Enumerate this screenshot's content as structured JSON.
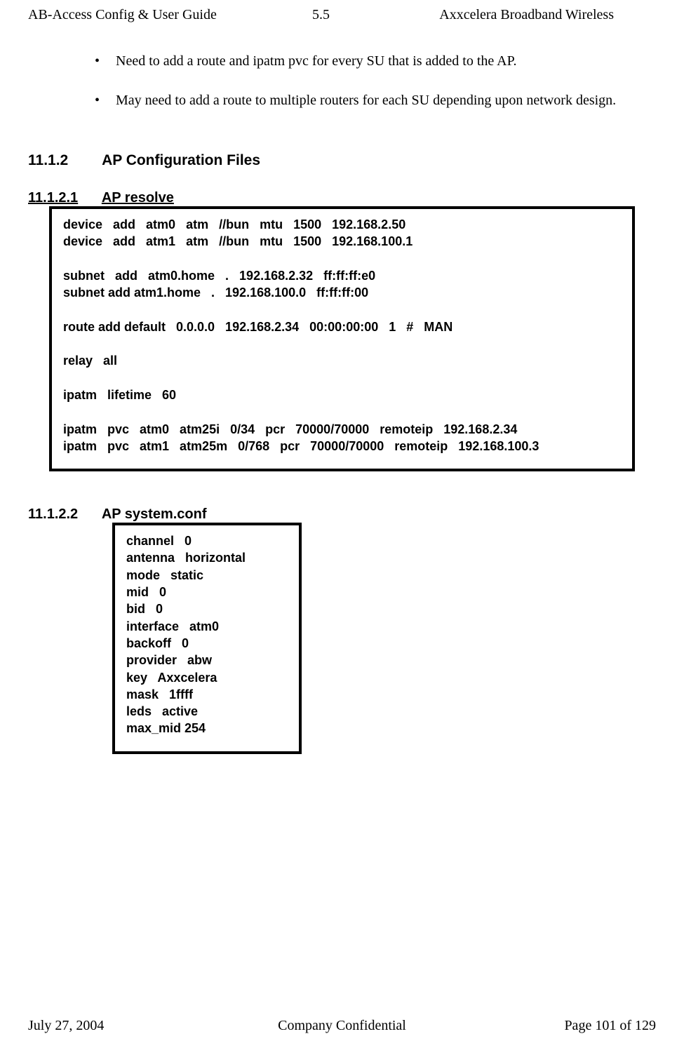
{
  "header": {
    "left": "AB-Access Config & User Guide",
    "center": "5.5",
    "right": "Axxcelera Broadband Wireless"
  },
  "bullets": [
    "Need to add a route and ipatm pvc for every SU that is added to the AP.",
    "May need to add a route to multiple routers for each SU depending upon network design."
  ],
  "sections": {
    "s11_1_2": {
      "number": "11.1.2",
      "title": "AP Configuration Files"
    },
    "s11_1_2_1": {
      "number": "11.1.2.1",
      "title": "AP resolve",
      "code": "device   add   atm0   atm   //bun   mtu   1500   192.168.2.50\ndevice   add   atm1   atm   //bun   mtu   1500   192.168.100.1\n\nsubnet   add   atm0.home   .   192.168.2.32   ff:ff:ff:e0\nsubnet add atm1.home   .   192.168.100.0   ff:ff:ff:00\n\nroute add default   0.0.0.0   192.168.2.34   00:00:00:00   1   #   MAN\n\nrelay   all\n\nipatm   lifetime   60\n\nipatm   pvc   atm0   atm25i   0/34   pcr   70000/70000   remoteip   192.168.2.34\nipatm   pvc   atm1   atm25m   0/768   pcr   70000/70000   remoteip   192.168.100.3"
    },
    "s11_1_2_2": {
      "number": "11.1.2.2",
      "title": "AP system.conf",
      "code": "channel   0\nantenna   horizontal\nmode   static\nmid   0\nbid   0\ninterface   atm0\nbackoff   0\nprovider   abw\nkey   Axxcelera\nmask   1ffff\nleds   active\nmax_mid 254"
    }
  },
  "footer": {
    "left": "July 27, 2004",
    "center": "Company Confidential",
    "right": "Page 101 of 129"
  }
}
